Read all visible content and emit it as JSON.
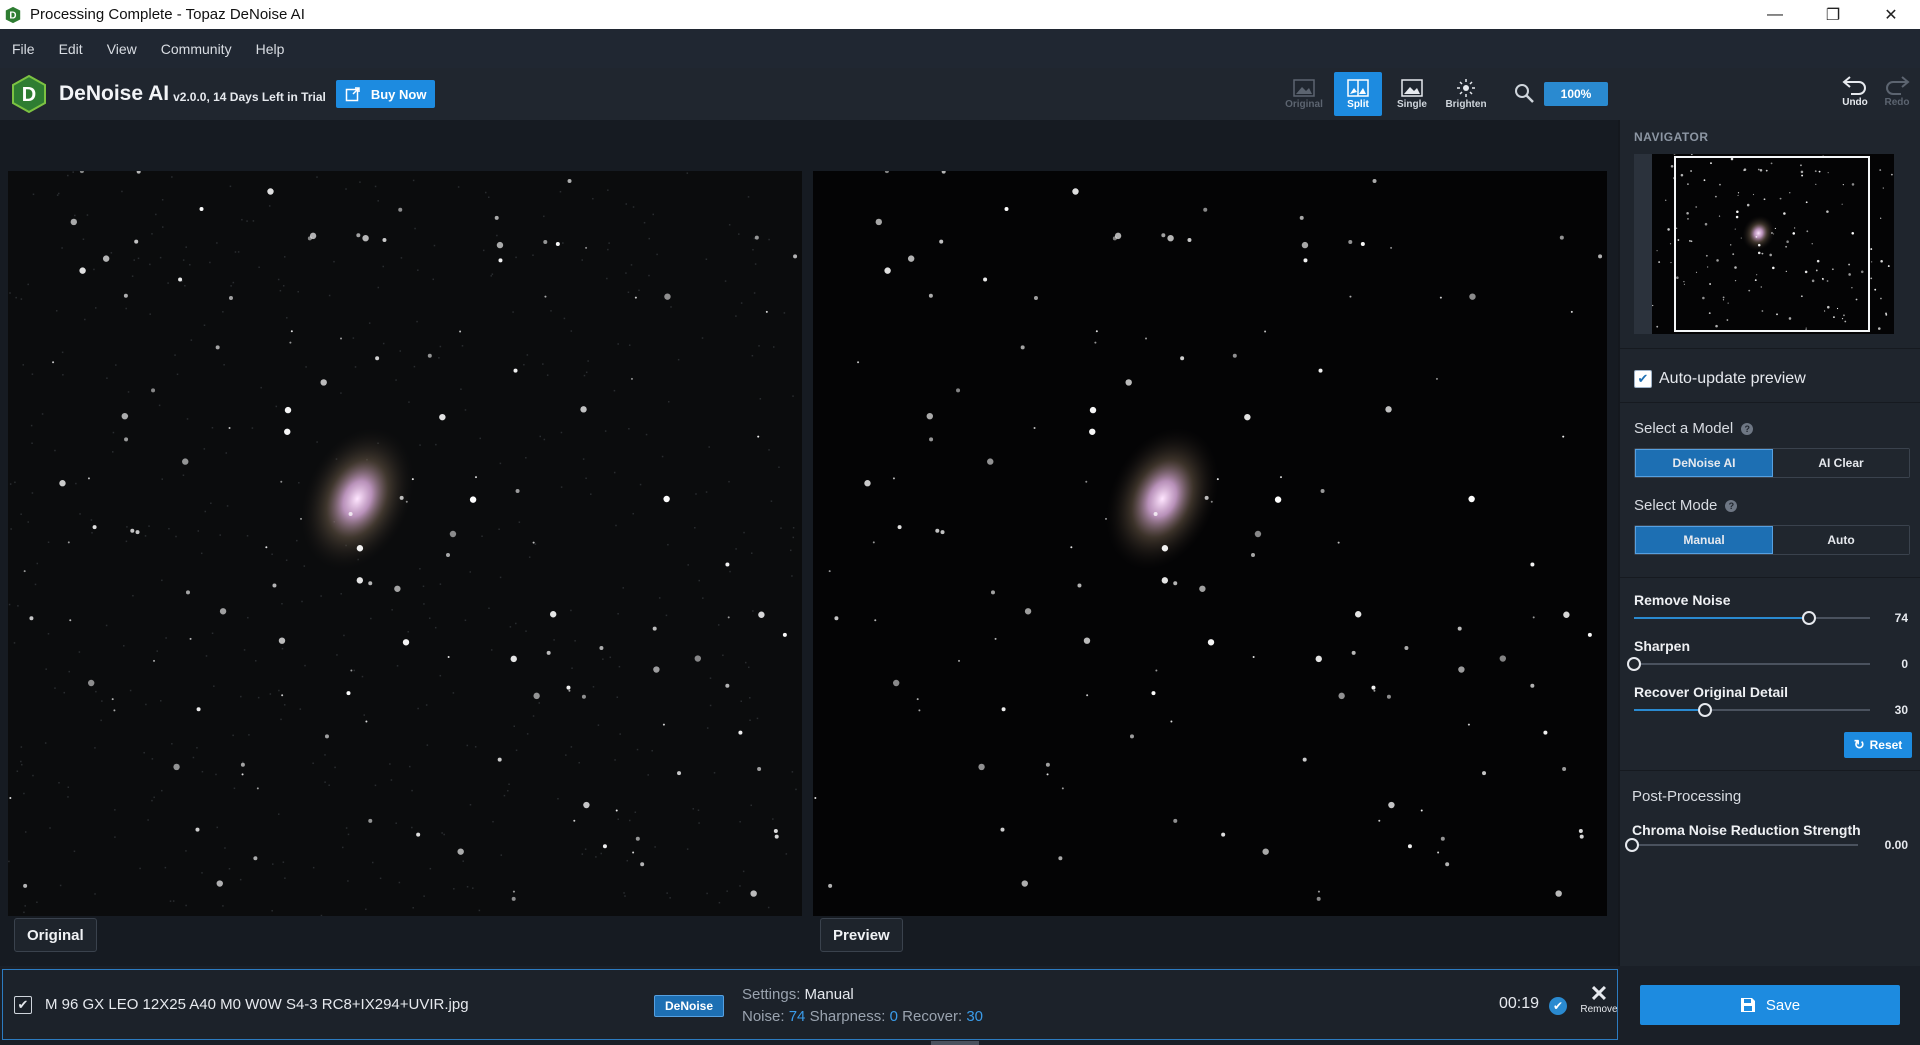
{
  "window": {
    "title": "Processing Complete - Topaz DeNoise AI",
    "controls": {
      "minimize": "—",
      "maximize": "❐",
      "close": "✕"
    }
  },
  "menu": [
    "File",
    "Edit",
    "View",
    "Community",
    "Help"
  ],
  "toolbar": {
    "brand": "DeNoise AI",
    "version": "v2.0.0, 14 Days Left in Trial",
    "buy_label": "Buy Now",
    "view_modes": [
      {
        "label": "Original",
        "state": "disabled",
        "icon": "image-icon"
      },
      {
        "label": "Split",
        "state": "active",
        "icon": "split-view-icon"
      },
      {
        "label": "Single",
        "state": "normal",
        "icon": "single-view-icon"
      },
      {
        "label": "Brighten",
        "state": "normal",
        "icon": "brighten-icon"
      }
    ],
    "zoom": "100%",
    "undo_label": "Undo",
    "redo_label": "Redo"
  },
  "panels": {
    "left_label": "Original",
    "right_label": "Preview"
  },
  "right_panel": {
    "navigator_title": "NAVIGATOR",
    "auto_update_label": "Auto-update preview",
    "auto_update_checked": true,
    "model_label": "Select a Model",
    "models": [
      {
        "label": "DeNoise AI",
        "active": true
      },
      {
        "label": "AI Clear",
        "active": false
      }
    ],
    "mode_label": "Select Mode",
    "modes": [
      {
        "label": "Manual",
        "active": true
      },
      {
        "label": "Auto",
        "active": false
      }
    ],
    "sliders": [
      {
        "label": "Remove Noise",
        "value": "74",
        "fraction": 0.74
      },
      {
        "label": "Sharpen",
        "value": "0",
        "fraction": 0.0
      },
      {
        "label": "Recover Original Detail",
        "value": "30",
        "fraction": 0.3
      }
    ],
    "reset_label": "Reset",
    "post_processing_label": "Post-Processing",
    "chroma": {
      "label": "Chroma Noise Reduction Strength",
      "value": "0.00",
      "fraction": 0.0
    }
  },
  "bottom": {
    "file_checked": true,
    "file_name": "M 96 GX LEO 12X25 A40 M0 W0W S4-3 RC8+IX294+UVIR.jpg",
    "model_tag": "DeNoise",
    "settings_label": "Settings:",
    "settings_value": "Manual",
    "noise_label": "Noise:",
    "noise_value": "74",
    "sharpness_label": "Sharpness:",
    "sharpness_value": "0",
    "recover_label": "Recover:",
    "recover_value": "30",
    "timer": "00:19",
    "remove_label": "Remove",
    "save_label": "Save"
  },
  "colors": {
    "accent": "#1d8be0",
    "accent_dark": "#1d6fb3",
    "background": "#1a1f27"
  }
}
